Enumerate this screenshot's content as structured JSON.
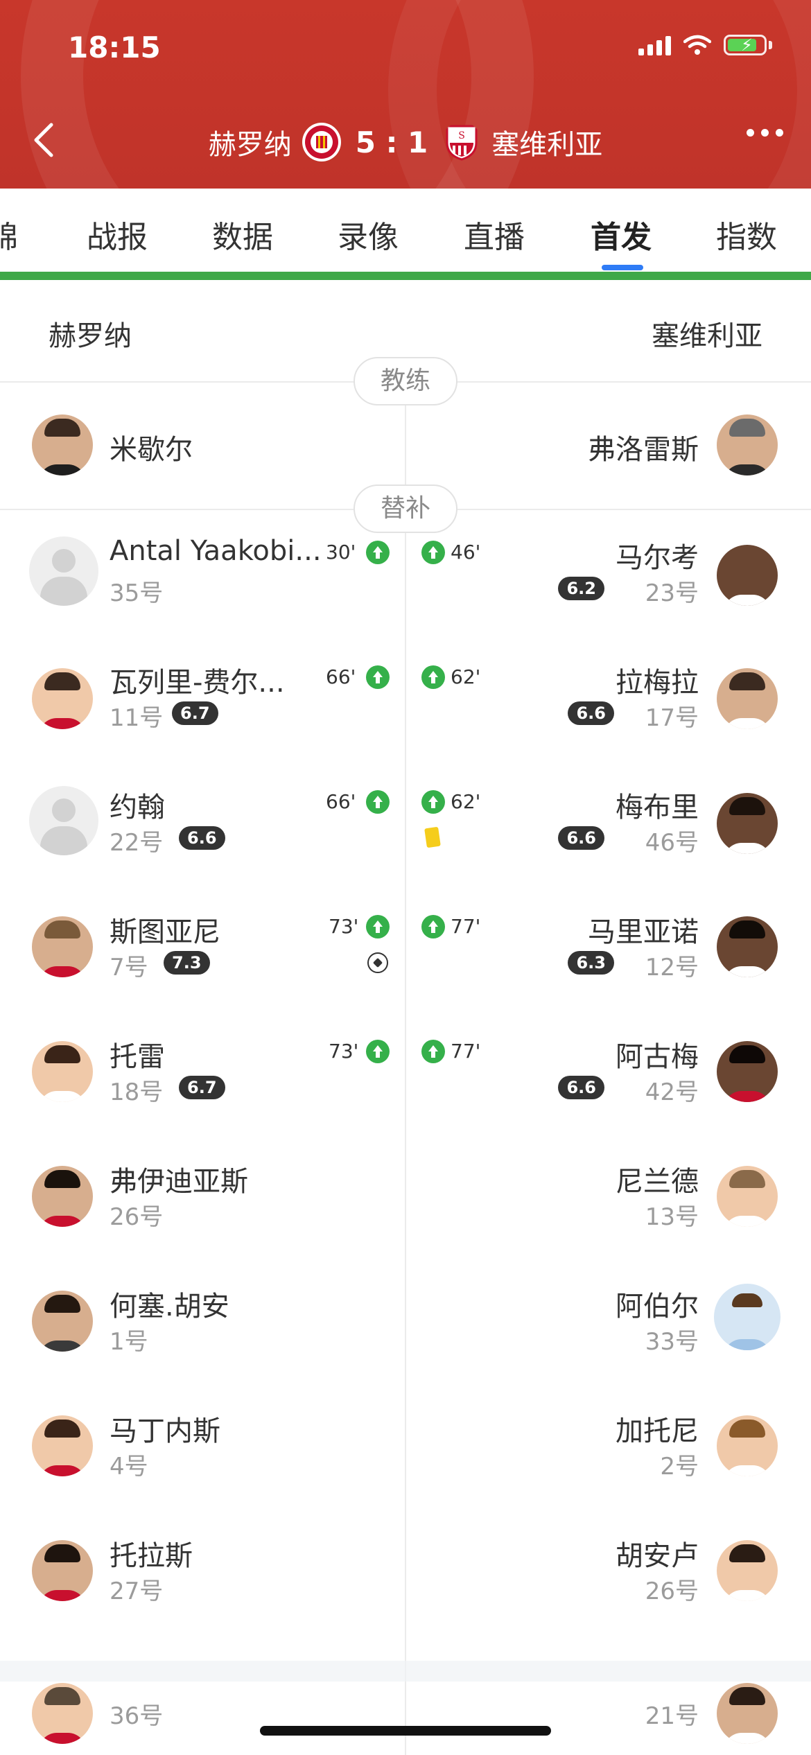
{
  "status_bar": {
    "time": "18:15"
  },
  "header": {
    "home_team": "赫罗纳",
    "score": "5 : 1",
    "away_team": "塞维利亚",
    "colors": {
      "background": "#c0332a",
      "text": "#ffffff"
    }
  },
  "tabs": {
    "items": [
      {
        "label": "锦"
      },
      {
        "label": "战报"
      },
      {
        "label": "数据"
      },
      {
        "label": "录像"
      },
      {
        "label": "直播"
      },
      {
        "label": "首发",
        "active": true
      },
      {
        "label": "指数"
      }
    ],
    "accent": "#2f7cf6",
    "bar_color": "#3fa848"
  },
  "teams": {
    "home": "赫罗纳",
    "away": "塞维利亚"
  },
  "sections": {
    "coach": "教练",
    "subs": "替补"
  },
  "coaches": {
    "home": "米歇尔",
    "away": "弗洛雷斯"
  },
  "home_subs": [
    {
      "name": "Antal Yaakobi...",
      "number": "35号",
      "rating": "",
      "minute": "30'",
      "events": [
        "sub-in"
      ]
    },
    {
      "name": "瓦列里-费尔...",
      "number": "11号",
      "rating": "6.7",
      "minute": "66'",
      "events": [
        "sub-in"
      ]
    },
    {
      "name": "约翰",
      "number": "22号",
      "rating": "6.6",
      "minute": "66'",
      "events": [
        "sub-in"
      ]
    },
    {
      "name": "斯图亚尼",
      "number": "7号",
      "rating": "7.3",
      "minute": "73'",
      "events": [
        "sub-in",
        "goal"
      ]
    },
    {
      "name": "托雷",
      "number": "18号",
      "rating": "6.7",
      "minute": "73'",
      "events": [
        "sub-in"
      ]
    },
    {
      "name": "弗伊迪亚斯",
      "number": "26号",
      "rating": "",
      "minute": "",
      "events": []
    },
    {
      "name": "何塞.胡安",
      "number": "1号",
      "rating": "",
      "minute": "",
      "events": []
    },
    {
      "name": "马丁内斯",
      "number": "4号",
      "rating": "",
      "minute": "",
      "events": []
    },
    {
      "name": "托拉斯",
      "number": "27号",
      "rating": "",
      "minute": "",
      "events": []
    },
    {
      "name": "",
      "number": "36号",
      "rating": "",
      "minute": "",
      "events": []
    }
  ],
  "away_subs": [
    {
      "name": "马尔考",
      "number": "23号",
      "rating": "6.2",
      "minute": "46'",
      "events": [
        "sub-in"
      ]
    },
    {
      "name": "拉梅拉",
      "number": "17号",
      "rating": "6.6",
      "minute": "62'",
      "events": [
        "sub-in"
      ]
    },
    {
      "name": "梅布里",
      "number": "46号",
      "rating": "6.6",
      "minute": "62'",
      "events": [
        "sub-in",
        "yellow-card"
      ]
    },
    {
      "name": "马里亚诺",
      "number": "12号",
      "rating": "6.3",
      "minute": "77'",
      "events": [
        "sub-in"
      ]
    },
    {
      "name": "阿古梅",
      "number": "42号",
      "rating": "6.6",
      "minute": "77'",
      "events": [
        "sub-in"
      ]
    },
    {
      "name": "尼兰德",
      "number": "13号",
      "rating": "",
      "minute": "",
      "events": []
    },
    {
      "name": "阿伯尔",
      "number": "33号",
      "rating": "",
      "minute": "",
      "events": []
    },
    {
      "name": "加托尼",
      "number": "2号",
      "rating": "",
      "minute": "",
      "events": []
    },
    {
      "name": "胡安卢",
      "number": "26号",
      "rating": "",
      "minute": "",
      "events": []
    },
    {
      "name": "",
      "number": "21号",
      "rating": "",
      "minute": "",
      "events": []
    }
  ],
  "icons": {
    "back": "chevron-left-icon",
    "more": "more-dots-icon",
    "sub_in": "substitution-in-icon",
    "goal": "football-icon",
    "yellow_card": "yellow-card-icon"
  }
}
